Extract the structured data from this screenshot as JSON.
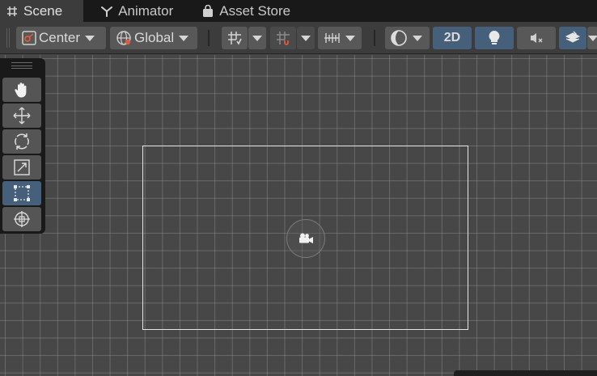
{
  "tabs": [
    {
      "label": "Scene",
      "icon": "hash-grid-icon",
      "active": true
    },
    {
      "label": "Animator",
      "icon": "animator-branch-icon",
      "active": false
    },
    {
      "label": "Asset Store",
      "icon": "shopping-bag-icon",
      "active": false
    }
  ],
  "toolbar": {
    "pivot_label": "Center",
    "pivot_icon": "pivot-center-icon",
    "space_label": "Global",
    "space_icon": "globe-icon",
    "grid_snap_icon": "grid-snap-icon",
    "increment_snap_icon": "increment-snap-icon",
    "grid_visibility_icon": "grid-ruler-icon",
    "draw_mode_icon": "shading-mode-icon",
    "mode_2d_label": "2D",
    "lighting_icon": "lightbulb-icon",
    "audio_icon": "audio-mute-icon",
    "effects_icon": "effects-layers-icon"
  },
  "tools": [
    {
      "name": "hand-tool",
      "icon": "hand-icon",
      "active": false
    },
    {
      "name": "move-tool",
      "icon": "move-arrows-icon",
      "active": false
    },
    {
      "name": "rotate-tool",
      "icon": "rotate-icon",
      "active": false
    },
    {
      "name": "scale-tool",
      "icon": "scale-icon",
      "active": false
    },
    {
      "name": "rect-tool",
      "icon": "rect-transform-icon",
      "active": true
    },
    {
      "name": "transform-tool",
      "icon": "transform-icon",
      "active": false
    }
  ],
  "colors": {
    "active_blue": "#46607c",
    "toolbar_bg": "#3c3c3c",
    "tabbar_bg": "#191919",
    "viewport_bg": "#474747"
  }
}
